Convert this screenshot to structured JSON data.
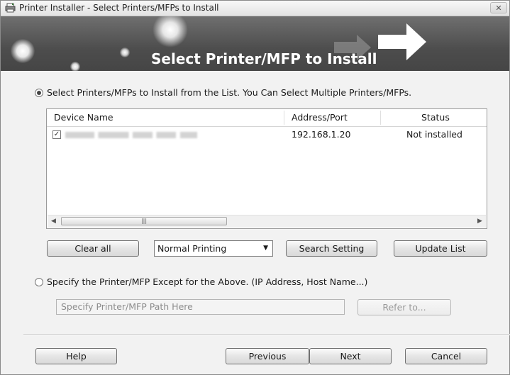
{
  "window": {
    "title": "Printer Installer - Select Printers/MFPs to Install",
    "close_glyph": "✕"
  },
  "banner": {
    "heading": "Select Printer/MFP to Install"
  },
  "select_from_list": {
    "label": "Select Printers/MFPs to Install from the List. You Can Select Multiple Printers/MFPs.",
    "selected": true
  },
  "device_list": {
    "columns": [
      "Device Name",
      "Address/Port",
      "Status"
    ],
    "rows": [
      {
        "checked": true,
        "address": "192.168.1.20",
        "status": "Not installed"
      }
    ],
    "scroll_grip": "|||",
    "scroll_left": "◀",
    "scroll_right": "▶"
  },
  "list_actions": {
    "clear_all": "Clear all",
    "printing_mode": {
      "selected": "Normal Printing",
      "arrow": "▼"
    },
    "search_setting": "Search Setting",
    "update_list": "Update List"
  },
  "specify_option": {
    "label": "Specify the Printer/MFP Except for the Above. (IP Address, Host Name...)",
    "selected": false,
    "path_placeholder": "Specify Printer/MFP Path Here",
    "refer_to": "Refer to..."
  },
  "footer": {
    "help": "Help",
    "previous": "Previous",
    "next": "Next",
    "cancel": "Cancel"
  },
  "colors": {
    "banner_gradient_top": "#6f6f6f",
    "banner_gradient_bottom": "#454545",
    "window_bg": "#f2f2f2"
  }
}
